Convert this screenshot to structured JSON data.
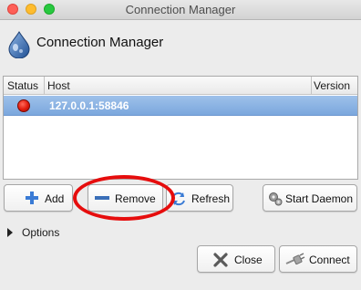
{
  "window": {
    "title": "Connection Manager"
  },
  "header": {
    "title": "Connection Manager",
    "icon": "deluge-droplet-icon"
  },
  "table": {
    "columns": [
      "Status",
      "Host",
      "Version"
    ],
    "rows": [
      {
        "status": "offline",
        "status_color": "#e01b0c",
        "host": "127.0.0.1:58846",
        "version": ""
      }
    ],
    "selected_row": 0
  },
  "buttons": {
    "add": "Add",
    "remove": "Remove",
    "refresh": "Refresh",
    "start_daemon": "Start Daemon",
    "close": "Close",
    "connect": "Connect"
  },
  "options": {
    "label": "Options",
    "expanded": false
  },
  "annotation": {
    "highlight_color": "#e60d0d",
    "highlighted": "remove"
  },
  "colors": {
    "selection": "#7ba7dd",
    "window_bg": "#ececec"
  }
}
